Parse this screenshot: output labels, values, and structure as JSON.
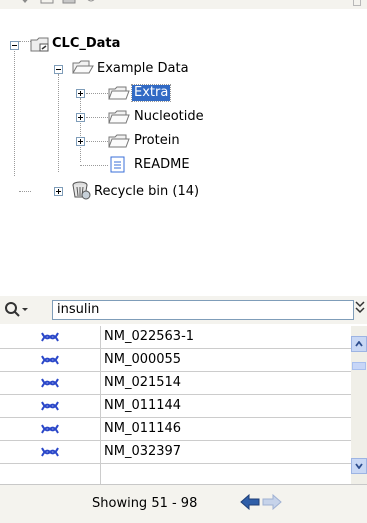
{
  "tree": {
    "root_label": "CLC_Data",
    "example_label": "Example Data",
    "children": [
      "Extra",
      "Nucleotide",
      "Protein",
      "README"
    ],
    "recycle_label": "Recycle bin (14)"
  },
  "search": {
    "value": "insulin"
  },
  "table": {
    "rows": [
      "NM_022563-1",
      "NM_000055",
      "NM_021514",
      "NM_011144",
      "NM_011146",
      "NM_032397"
    ]
  },
  "footer": {
    "showing": "Showing 51 - 98"
  },
  "icons": {
    "search": "search-icon",
    "more_options": "double-chevron-down-icon",
    "prev": "arrow-left-icon",
    "next": "arrow-right-icon"
  },
  "colors": {
    "selection": "#316ac5",
    "nav_active": "#2f5ea8",
    "nav_disabled": "#c6d3ea"
  }
}
